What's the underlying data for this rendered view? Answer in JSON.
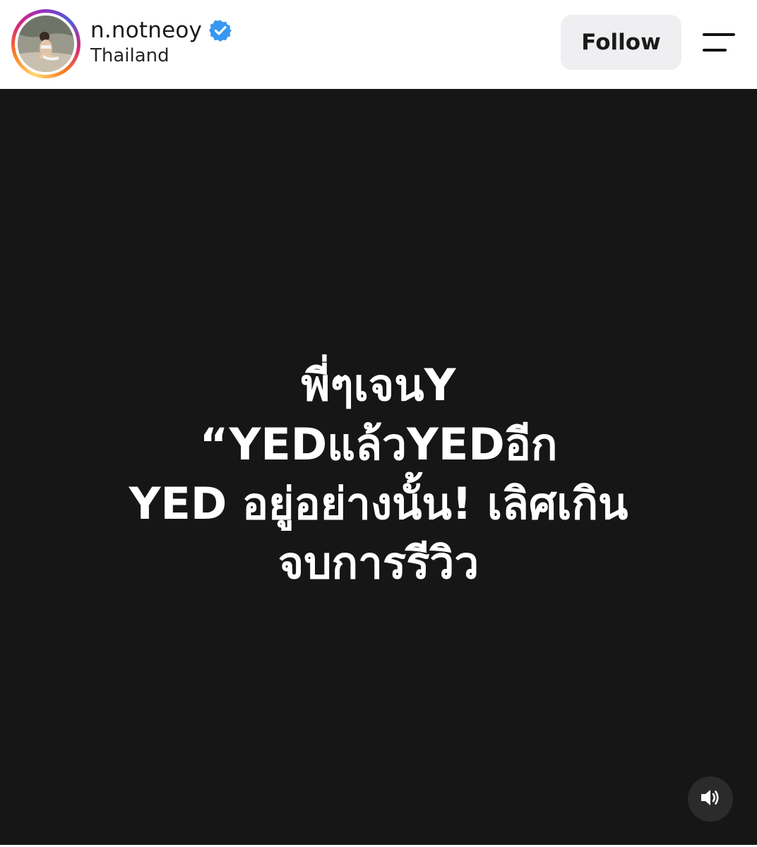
{
  "post_header": {
    "username": "n.notneoy",
    "verified_icon": "verified-badge-icon",
    "location": "Thailand",
    "follow_label": "Follow",
    "menu_icon": "menu-icon",
    "accent_color": "#3897f0"
  },
  "media": {
    "background_color": "#161616",
    "caption_lines": [
      "พี่ๆเจนY",
      "“YEDแล้วYEDอีก",
      "YED อยู่อย่างนั้น! เลิศเกิน",
      "จบการรีวิว"
    ],
    "sound_icon": "speaker-volume-icon"
  }
}
